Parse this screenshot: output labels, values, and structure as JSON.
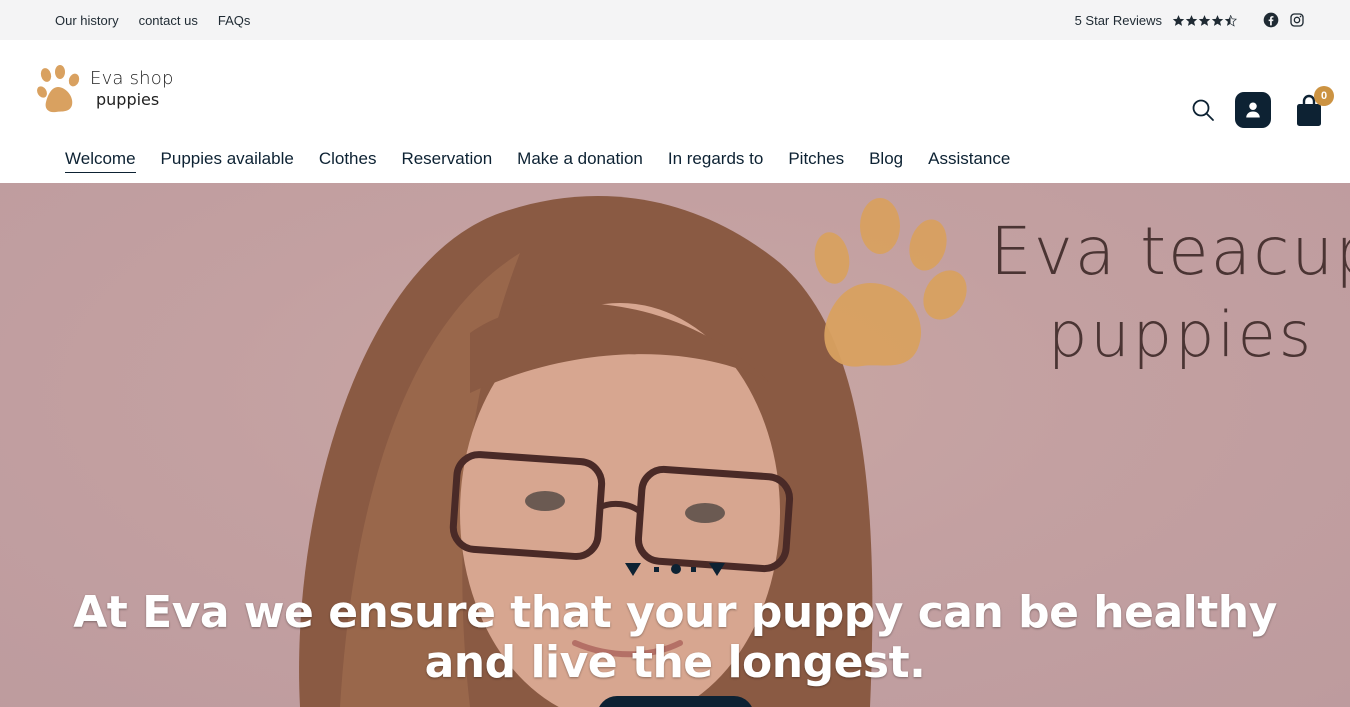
{
  "topbar": {
    "links": [
      "Our history",
      "contact us",
      "FAQs"
    ],
    "reviews_label": "5 Star Reviews",
    "rating": 4.5,
    "rating_max": 5
  },
  "header": {
    "logo": {
      "line1": "Eva shop",
      "line2": "puppies"
    },
    "cart_count": "0"
  },
  "nav": {
    "items": [
      "Welcome",
      "Puppies available",
      "Clothes",
      "Reservation",
      "Make a donation",
      "In regards to",
      "Pitches",
      "Blog",
      "Assistance"
    ],
    "active_index": 0
  },
  "hero": {
    "brand_line1": "Eva teacup",
    "brand_line2": "puppies",
    "headline": "At Eva we ensure that your puppy can be healthy and live the longest."
  },
  "colors": {
    "navy": "#0d2233",
    "accent": "#cc9342",
    "paw": "#d9a160",
    "hero_bg": "#c3a0a1"
  },
  "icons": [
    "star-icon",
    "facebook-icon",
    "instagram-icon",
    "search-icon",
    "user-icon",
    "shopping-bag-icon",
    "paw-icon"
  ]
}
